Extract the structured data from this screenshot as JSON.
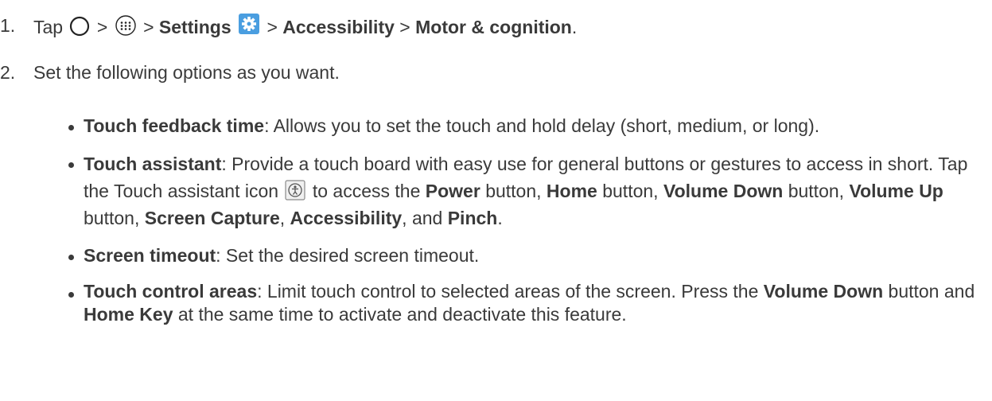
{
  "step1": {
    "number": "1.",
    "tap": "Tap",
    "sep1": ">",
    "sep2": ">",
    "settings": "Settings",
    "sep3": ">",
    "accessibility": "Accessibility",
    "sep4": ">",
    "motor": "Motor & cognition",
    "end": "."
  },
  "step2": {
    "number": "2.",
    "text": "Set the following options as you want."
  },
  "bullets": {
    "b1": {
      "term": "Touch feedback time",
      "desc": ": Allows you to set the touch and hold delay (short, medium, or long)."
    },
    "b2": {
      "term": "Touch assistant",
      "desc1": ": Provide a touch board with easy use for general buttons or gestures to access in short. Tap the Touch assistant icon",
      "desc2": "to access the",
      "power": "Power",
      "t1": "button,",
      "home": "Home",
      "t2": "button,",
      "voldown": "Volume Down",
      "t3": "button,",
      "volup": "Volume Up",
      "t4": "button,",
      "capture": "Screen Capture",
      "t5": ",",
      "accessibility": "Accessibility",
      "t6": ", and",
      "pinch": "Pinch",
      "t7": "."
    },
    "b3": {
      "term": "Screen timeout",
      "desc": ": Set the desired screen timeout."
    },
    "b4": {
      "term": "Touch control areas",
      "desc1": ": Limit touch control to selected areas of the screen. Press the",
      "voldown": "Volume Down",
      "desc2": "button and",
      "homekey": "Home Key",
      "desc3": "at the same time to activate and deactivate this feature."
    }
  },
  "icons": {
    "home": "home-circle-icon",
    "apps": "apps-icon",
    "settings": "settings-gear-icon",
    "touch_assistant": "touch-assistant-icon",
    "settings_color": "#4a9ee0"
  }
}
